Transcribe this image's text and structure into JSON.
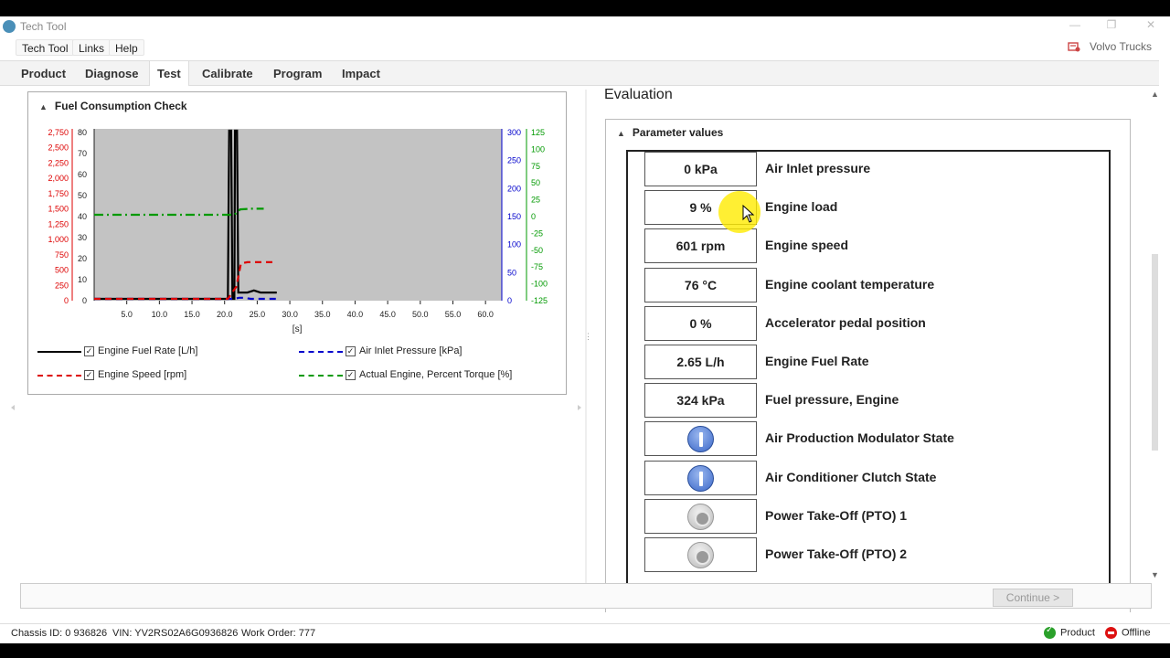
{
  "window": {
    "title": "Tech Tool"
  },
  "menu": {
    "items": [
      "Tech Tool",
      "Links",
      "Help"
    ],
    "brand": "Volvo Trucks"
  },
  "tabs": [
    "Product",
    "Diagnose",
    "Test",
    "Calibrate",
    "Program",
    "Impact"
  ],
  "active_tab": "Test",
  "fuel_check": {
    "title": "Fuel Consumption Check",
    "legend": [
      {
        "label": "Engine Fuel Rate [L/h]",
        "color": "#000000",
        "style": "solid"
      },
      {
        "label": "Air Inlet Pressure [kPa]",
        "color": "#0000cc",
        "style": "dashed"
      },
      {
        "label": "Engine Speed [rpm]",
        "color": "#dd0000",
        "style": "dashed"
      },
      {
        "label": "Actual Engine, Percent Torque [%]",
        "color": "#009900",
        "style": "dashdot"
      }
    ]
  },
  "chart_data": {
    "type": "line",
    "xlabel": "[s]",
    "xlim": [
      0,
      62.5
    ],
    "x_ticks": [
      "5.0",
      "10.0",
      "15.0",
      "20.0",
      "25.0",
      "30.0",
      "35.0",
      "40.0",
      "45.0",
      "50.0",
      "55.0",
      "60.0"
    ],
    "axes": {
      "engine_speed": {
        "ticks": [
          "2,750",
          "2,500",
          "2,250",
          "2,000",
          "1,750",
          "1,500",
          "1,250",
          "1,000",
          "750",
          "500",
          "250",
          "0"
        ],
        "color": "#dd0000",
        "range": [
          0,
          2750
        ]
      },
      "fuel_rate": {
        "ticks": [
          "80",
          "70",
          "60",
          "50",
          "40",
          "30",
          "20",
          "10",
          "0"
        ],
        "color": "#222222",
        "range": [
          0,
          80
        ]
      },
      "air_inlet": {
        "ticks": [
          "300",
          "250",
          "200",
          "150",
          "100",
          "50",
          "0"
        ],
        "color": "#0000cc",
        "range": [
          0,
          300
        ]
      },
      "torque": {
        "ticks": [
          "125",
          "100",
          "75",
          "50",
          "25",
          "0",
          "-25",
          "-50",
          "-75",
          "-100",
          "-125"
        ],
        "color": "#009900",
        "range": [
          -125,
          125
        ]
      }
    },
    "series": [
      {
        "name": "Engine Fuel Rate [L/h]",
        "axis": "fuel_rate",
        "color": "#000000",
        "dash": "",
        "points": [
          [
            0,
            0
          ],
          [
            20.5,
            0
          ],
          [
            20.7,
            80
          ],
          [
            21.0,
            80
          ],
          [
            21.2,
            0
          ],
          [
            21.5,
            0
          ],
          [
            21.6,
            80
          ],
          [
            21.9,
            80
          ],
          [
            22.1,
            3
          ],
          [
            23.5,
            3
          ],
          [
            24.5,
            4
          ],
          [
            25.5,
            3
          ],
          [
            27.5,
            3
          ],
          [
            28,
            3
          ]
        ]
      },
      {
        "name": "Air Inlet Pressure [kPa]",
        "axis": "air_inlet",
        "color": "#0000cc",
        "dash": "7,5",
        "points": [
          [
            0,
            0
          ],
          [
            21.5,
            0
          ],
          [
            22.2,
            2
          ],
          [
            23,
            2
          ],
          [
            24,
            0
          ],
          [
            28,
            0
          ]
        ]
      },
      {
        "name": "Engine Speed [rpm]",
        "axis": "engine_speed",
        "color": "#dd0000",
        "dash": "7,5",
        "points": [
          [
            0,
            0
          ],
          [
            20.5,
            0
          ],
          [
            21.8,
            200
          ],
          [
            22.5,
            580
          ],
          [
            23.5,
            600
          ],
          [
            28,
            600
          ]
        ]
      },
      {
        "name": "Actual Engine, Percent Torque [%]",
        "axis": "torque",
        "color": "#009900",
        "dash": "10,4,2,4",
        "points": [
          [
            0,
            0
          ],
          [
            21.5,
            0
          ],
          [
            22.4,
            8
          ],
          [
            24,
            9
          ],
          [
            26,
            9
          ]
        ]
      }
    ]
  },
  "evaluation": {
    "title": "Evaluation",
    "section": "Parameter values",
    "params": [
      {
        "value": "0 kPa",
        "label": "Air Inlet pressure",
        "icon": ""
      },
      {
        "value": "9 %",
        "label": "Engine load",
        "icon": ""
      },
      {
        "value": "601 rpm",
        "label": "Engine speed",
        "icon": ""
      },
      {
        "value": "76 °C",
        "label": "Engine coolant temperature",
        "icon": ""
      },
      {
        "value": "0 %",
        "label": "Accelerator pedal position",
        "icon": ""
      },
      {
        "value": "2.65 L/h",
        "label": "Engine Fuel Rate",
        "icon": ""
      },
      {
        "value": "324 kPa",
        "label": "Fuel pressure, Engine",
        "icon": ""
      },
      {
        "value": "",
        "label": "Air Production Modulator State",
        "icon": "on-state-icon"
      },
      {
        "value": "",
        "label": "Air Conditioner Clutch State",
        "icon": "on-state-icon"
      },
      {
        "value": "",
        "label": "Power Take-Off (PTO) 1",
        "icon": "off-state-icon"
      },
      {
        "value": "",
        "label": "Power Take-Off (PTO) 2",
        "icon": "off-state-icon"
      }
    ]
  },
  "continue_label": "Continue >",
  "status": {
    "chassis": "Chassis ID: 0 936826",
    "vin": "VIN: YV2RS02A6G0936826",
    "work_order": "Work Order: 777",
    "product": "Product",
    "offline": "Offline"
  }
}
